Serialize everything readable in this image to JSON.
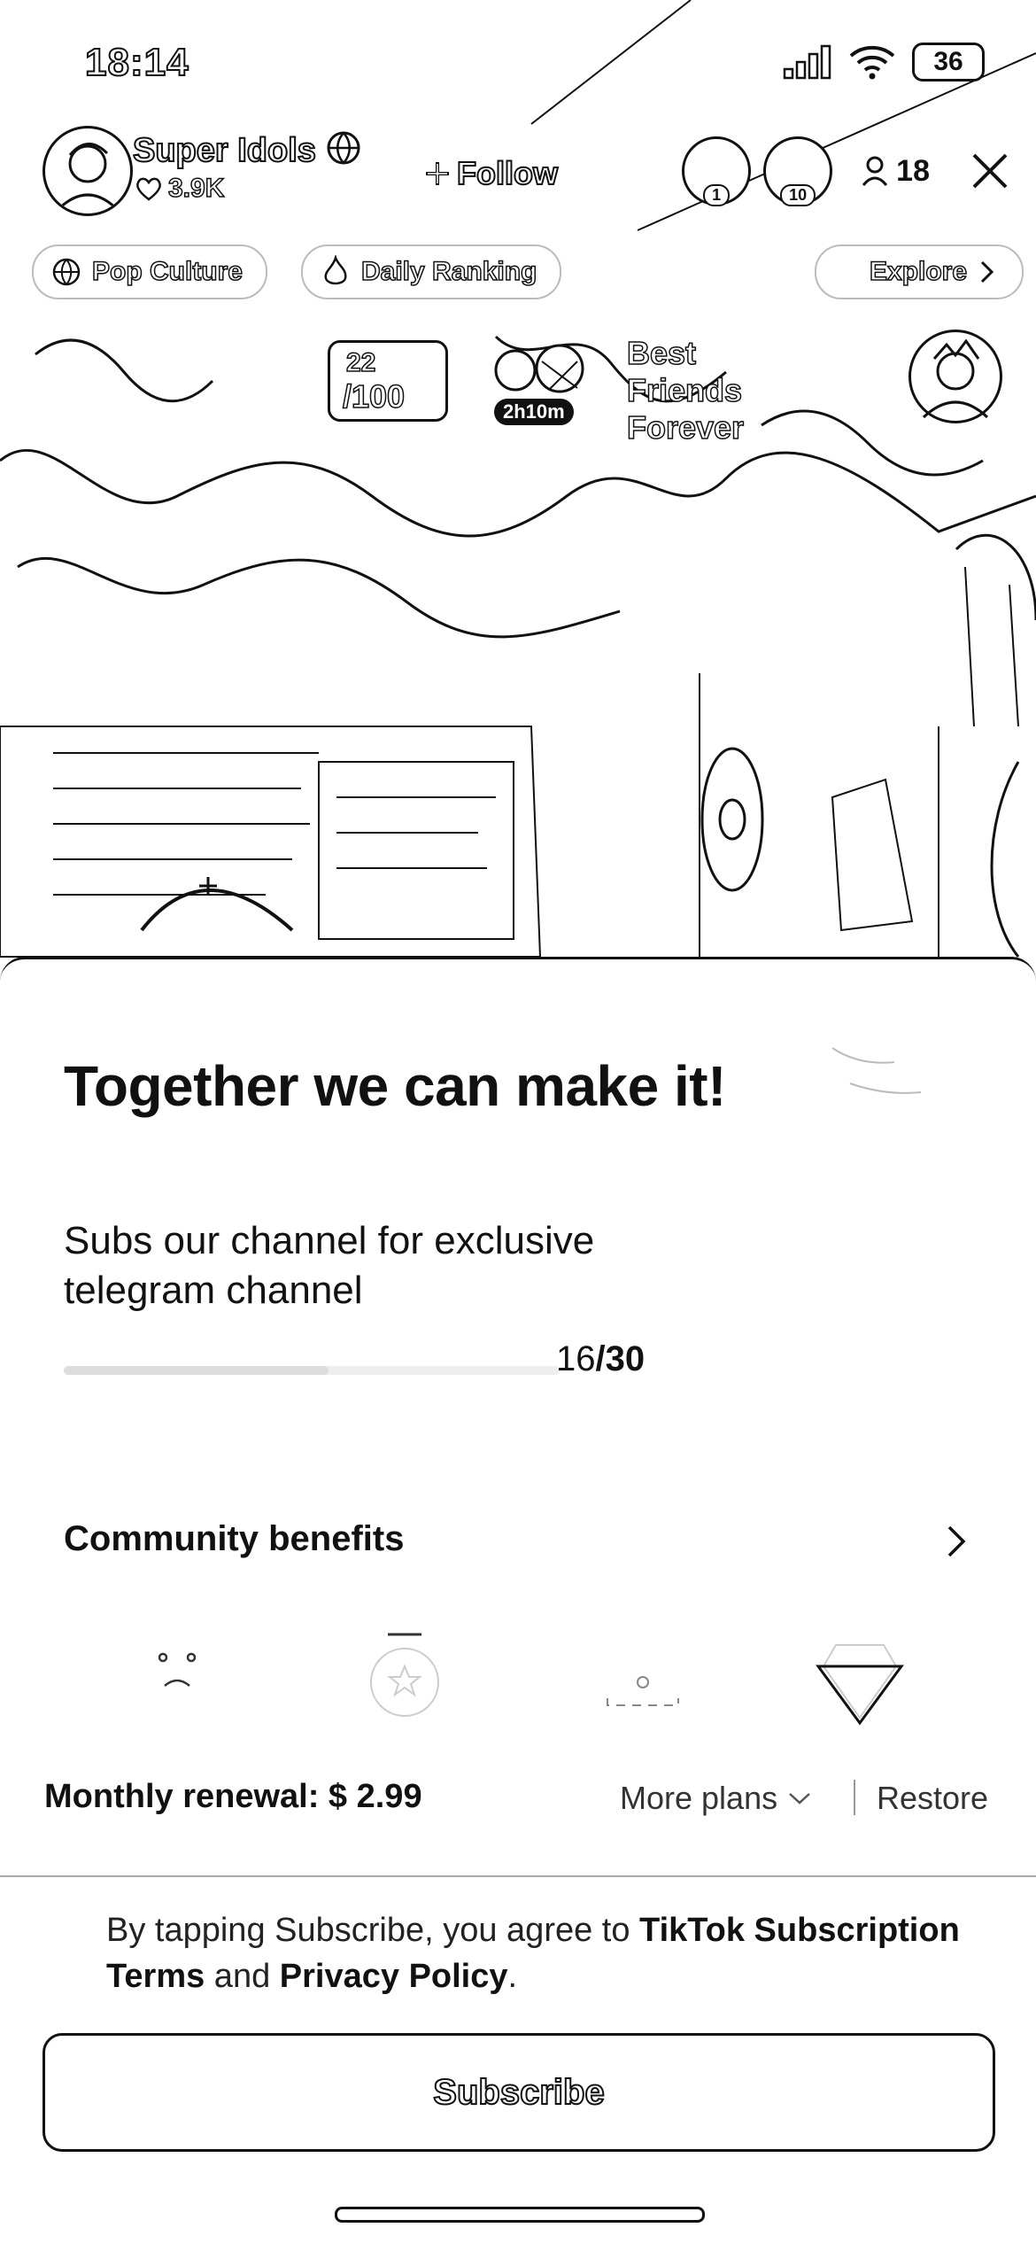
{
  "status_bar": {
    "time": "18:14",
    "battery": "36"
  },
  "host": {
    "name": "Super Idols",
    "likes": "3.9K",
    "follow_label": "Follow"
  },
  "viewers": {
    "count": "18",
    "badges": [
      "1",
      "10"
    ]
  },
  "chips": {
    "pop_culture": "Pop Culture",
    "daily_ranking": "Daily Ranking",
    "explore": "Explore"
  },
  "pk_battle": {
    "score": "22",
    "total": "/100",
    "timer": "2h10m",
    "title_line1": "Best Friends",
    "title_line2": "Forever"
  },
  "subscription": {
    "headline": "Together we can make it!",
    "subtitle": "Subs our channel for exclusive telegram channel",
    "progress": {
      "current": 16,
      "goal": 30,
      "label_current": "16",
      "label_goal": "/30"
    },
    "benefits_label": "Community benefits",
    "benefit_icons": [
      "emoji-face-icon",
      "badge-star-icon",
      "chat-bubble-icon",
      "diamond-icon"
    ],
    "renewal": "Monthly renewal: $ 2.99",
    "more_plans": "More plans",
    "restore": "Restore",
    "terms": {
      "prefix": "By tapping Subscribe, you agree to ",
      "link1": "TikTok Subscription Terms",
      "middle": " and ",
      "link2": "Privacy Policy",
      "suffix": "."
    },
    "subscribe_label": "Subscribe"
  }
}
